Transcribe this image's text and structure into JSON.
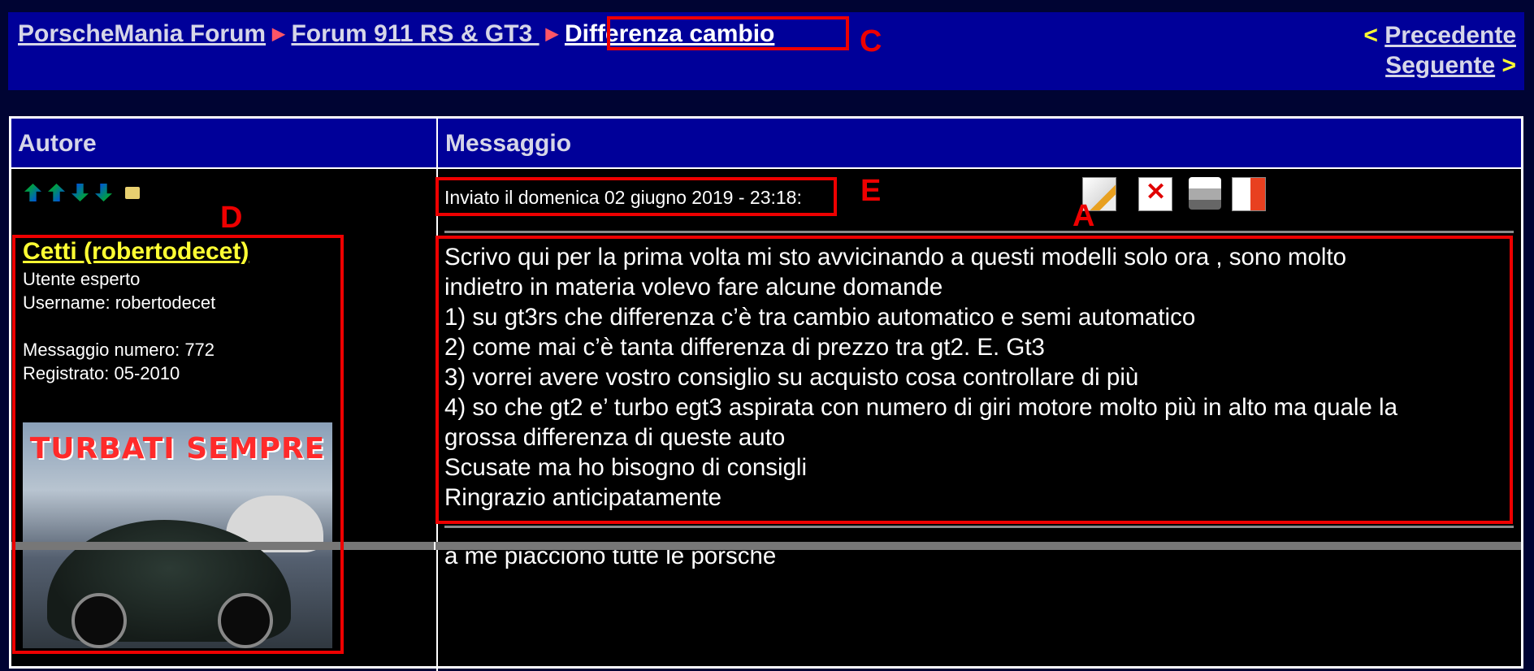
{
  "breadcrumb": {
    "items": [
      "PorscheMania Forum",
      "Forum 911 RS & GT3 ",
      "Differenza cambio "
    ],
    "separator": "▶"
  },
  "pagination": {
    "prev_chevron": "<",
    "prev_label": "Precedente",
    "next_label": "Seguente",
    "next_chevron": ">"
  },
  "table": {
    "col_author": "Autore",
    "col_message": "Messaggio"
  },
  "post": {
    "posted_on": "Inviato il domenica 02 giugno 2019 - 23:18:",
    "author": {
      "display_name": "Cetti (robertodecet)",
      "rank": "Utente esperto",
      "username": "Username: robertodecet",
      "message_count": "Messaggio numero: 772",
      "registered": "Registrato: 05-2010",
      "avatar_text": "TURBATI SEMPRE"
    },
    "body_lines": [
      "Scrivo qui per la prima volta mi sto avvicinando a questi modelli solo ora , sono molto",
      "indietro in materia volevo fare alcune domande",
      "1) su gt3rs che differenza c’è tra cambio automatico e semi automatico",
      "2) come mai c’è tanta differenza di prezzo tra gt2. E. Gt3",
      "3) vorrei avere vostro consiglio su acquisto cosa controllare di più",
      "4) so che gt2 e’ turbo egt3 aspirata con numero di giri motore molto più in alto ma quale la",
      "grossa differenza di queste auto",
      "Scusate ma ho bisogno di consigli",
      "Ringrazio anticipatamente"
    ],
    "signature": "a me piacciono tutte le porsche",
    "tools": [
      "edit-icon",
      "delete-icon",
      "print-icon",
      "reply-icon"
    ]
  },
  "annotations": {
    "A": "A",
    "C": "C",
    "D": "D",
    "E": "E",
    "color": "#ee0000"
  },
  "colors": {
    "page_bg": "#000433",
    "bar_bg": "#000099",
    "link": "#d6d6e8",
    "username": "#ffff33"
  }
}
